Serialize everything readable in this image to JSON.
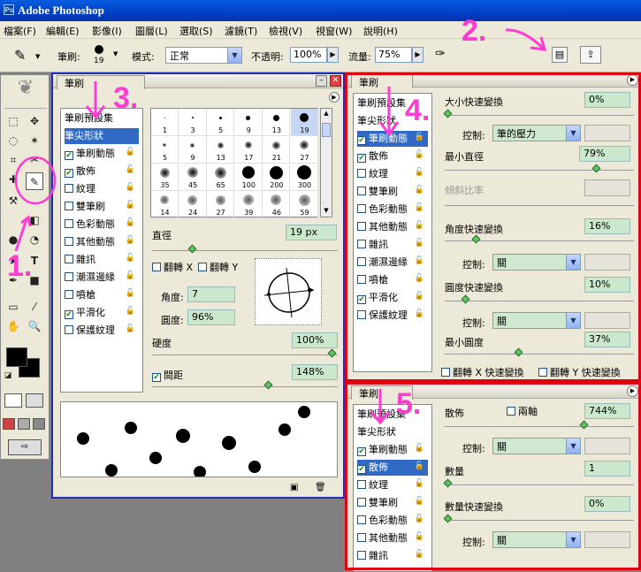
{
  "app_title": "Adobe Photoshop",
  "menu": [
    "檔案(F)",
    "編輯(E)",
    "影像(I)",
    "圖層(L)",
    "選取(S)",
    "濾鏡(T)",
    "檢視(V)",
    "視窗(W)",
    "說明(H)"
  ],
  "options": {
    "brush_label": "筆刷:",
    "brush_size": "19",
    "mode_label": "模式:",
    "mode_value": "正常",
    "opacity_label": "不透明:",
    "opacity_value": "100%",
    "flow_label": "流量:",
    "flow_value": "75%"
  },
  "annotations": {
    "a1": "1.",
    "a2": "2.",
    "a3": "3.",
    "a4": "4.",
    "a5": "5."
  },
  "brushes_panel": {
    "tab": "筆刷",
    "list": [
      {
        "label": "筆刷預設集",
        "checked": null
      },
      {
        "label": "筆尖形狀",
        "checked": null,
        "selected": true
      },
      {
        "label": "筆刷動態",
        "checked": true
      },
      {
        "label": "散佈",
        "checked": true
      },
      {
        "label": "紋理",
        "checked": false
      },
      {
        "label": "雙筆刷",
        "checked": false
      },
      {
        "label": "色彩動態",
        "checked": false
      },
      {
        "label": "其他動態",
        "checked": false
      },
      {
        "label": "雜訊",
        "checked": false
      },
      {
        "label": "潮濕邊緣",
        "checked": false
      },
      {
        "label": "噴槍",
        "checked": false
      },
      {
        "label": "平滑化",
        "checked": true
      },
      {
        "label": "保護紋理",
        "checked": false
      }
    ],
    "tip_sizes": [
      "1",
      "3",
      "5",
      "9",
      "13",
      "19",
      "5",
      "9",
      "13",
      "17",
      "21",
      "27",
      "35",
      "45",
      "65",
      "100",
      "200",
      "300",
      "14",
      "24",
      "27",
      "39",
      "46",
      "59"
    ],
    "diameter_label": "直徑",
    "diameter_value": "19 px",
    "flip_x": "翻轉 X",
    "flip_y": "翻轉 Y",
    "angle_label": "角度:",
    "angle_value": "7",
    "roundness_label": "圓度:",
    "roundness_value": "96%",
    "hardness_label": "硬度",
    "hardness_value": "100%",
    "spacing_label": "間距",
    "spacing_value": "148%"
  },
  "dynamics_panel": {
    "tab": "筆刷",
    "list": [
      {
        "label": "筆刷預設集",
        "checked": null
      },
      {
        "label": "筆尖形狀",
        "checked": null
      },
      {
        "label": "筆刷動態",
        "checked": true,
        "selected": true
      },
      {
        "label": "散佈",
        "checked": true
      },
      {
        "label": "紋理",
        "checked": false
      },
      {
        "label": "雙筆刷",
        "checked": false
      },
      {
        "label": "色彩動態",
        "checked": false
      },
      {
        "label": "其他動態",
        "checked": false
      },
      {
        "label": "雜訊",
        "checked": false
      },
      {
        "label": "潮濕邊緣",
        "checked": false
      },
      {
        "label": "噴槍",
        "checked": false
      },
      {
        "label": "平滑化",
        "checked": true
      },
      {
        "label": "保護紋理",
        "checked": false
      }
    ],
    "size_jitter_label": "大小快速變換",
    "size_jitter_value": "0%",
    "control_label": "控制:",
    "size_control": "筆的壓力",
    "min_diameter_label": "最小直徑",
    "min_diameter_value": "79%",
    "tilt_label": "傾斜比率",
    "angle_jitter_label": "角度快速變換",
    "angle_jitter_value": "16%",
    "angle_control": "關",
    "round_jitter_label": "圓度快速變換",
    "round_jitter_value": "10%",
    "round_control": "關",
    "min_round_label": "最小圓度",
    "min_round_value": "37%",
    "flip_x_jitter": "翻轉 X 快速變換",
    "flip_y_jitter": "翻轉 Y 快速變換"
  },
  "scatter_panel": {
    "tab": "筆刷",
    "list": [
      {
        "label": "筆刷預設集",
        "checked": null
      },
      {
        "label": "筆尖形狀",
        "checked": null
      },
      {
        "label": "筆刷動態",
        "checked": true
      },
      {
        "label": "散佈",
        "checked": true,
        "selected": true
      },
      {
        "label": "紋理",
        "checked": false
      },
      {
        "label": "雙筆刷",
        "checked": false
      },
      {
        "label": "色彩動態",
        "checked": false
      },
      {
        "label": "其他動態",
        "checked": false
      },
      {
        "label": "雜訊",
        "checked": false
      }
    ],
    "scatter_label": "散佈",
    "both_axes": "兩軸",
    "scatter_value": "744%",
    "control_label": "控制:",
    "scatter_control": "關",
    "count_label": "數量",
    "count_value": "1",
    "count_jitter_label": "數量快速變換",
    "count_jitter_value": "0%",
    "count_control": "關"
  },
  "colors": {
    "accent": "#316ac5",
    "annot": "#ff3cd2",
    "highlight": "#e00010"
  }
}
